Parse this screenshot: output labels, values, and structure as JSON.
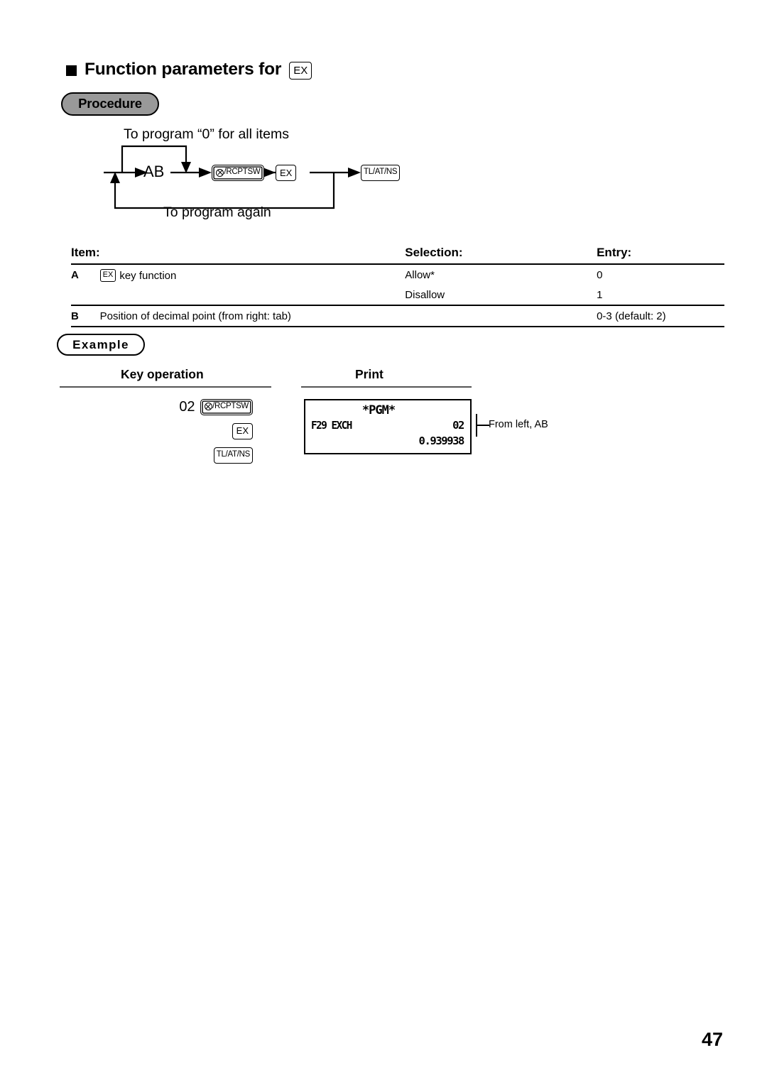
{
  "document": {
    "page_number": "47"
  },
  "section": {
    "title": "Function parameters for",
    "title_key": "EX",
    "bullet": "filled-square"
  },
  "procedure": {
    "badge_label": "Procedure",
    "badge_fill": "#999999",
    "top_label": "To program “0” for all items",
    "bottom_label": "To program again",
    "node_ab": "AB",
    "keys": [
      {
        "name": "multiply-rcptsw-key",
        "label": "/RCPTSW",
        "has_circle_x": true
      },
      {
        "name": "ex-key",
        "label": "EX",
        "has_circle_x": false
      },
      {
        "name": "tl-at-ns-key",
        "label": "TL/AT/NS",
        "has_circle_x": false
      }
    ]
  },
  "table": {
    "headers": {
      "item": "Item:",
      "description": "",
      "selection": "Selection:",
      "entry": "Entry:"
    },
    "rows": [
      {
        "code": "A",
        "desc_key": "EX",
        "desc_text": "key function",
        "selection": "Allow*",
        "entry": "0"
      },
      {
        "code": "",
        "desc_key": "",
        "desc_text": "",
        "selection": "Disallow",
        "entry": "1"
      },
      {
        "code": "B",
        "desc_key": "",
        "desc_text": "Position of decimal point (from right: tab)",
        "selection": "",
        "entry": "0-3 (default: 2)"
      }
    ]
  },
  "example": {
    "badge_label": "Example",
    "key_operation_header": "Key operation",
    "print_header": "Print",
    "key_operation": {
      "entry_number": "02",
      "steps": [
        {
          "name": "multiply-rcptsw-key",
          "label": "/RCPTSW",
          "has_circle_x": true
        },
        {
          "name": "ex-key",
          "label": "EX",
          "has_circle_x": false
        },
        {
          "name": "tl-at-ns-key",
          "label": "TL/AT/NS",
          "has_circle_x": false
        }
      ]
    },
    "print": {
      "header_line": "*PGM*",
      "description": "F29 EXCH",
      "value": "02",
      "rate": "0.939938"
    },
    "callout": "From left, AB"
  }
}
